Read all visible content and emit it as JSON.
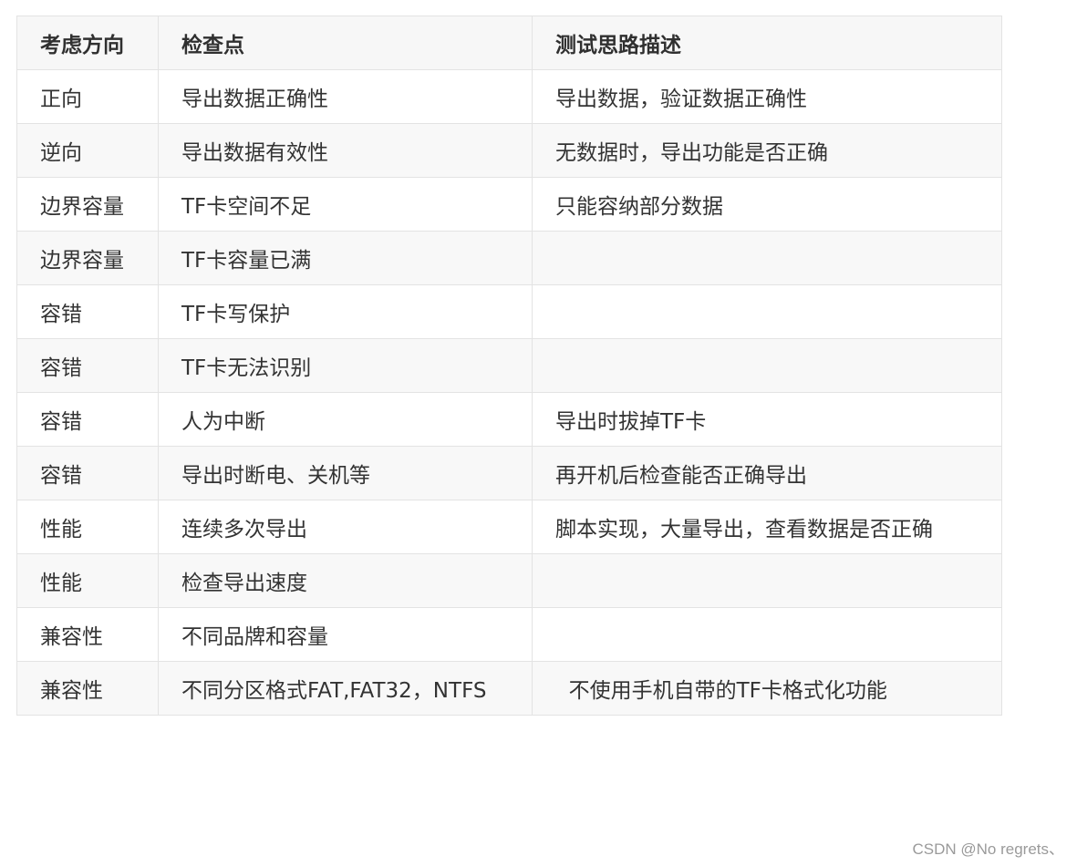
{
  "table": {
    "headers": [
      "考虑方向",
      "检查点",
      "测试思路描述"
    ],
    "rows": [
      [
        "正向",
        "导出数据正确性",
        "导出数据，验证数据正确性"
      ],
      [
        "逆向",
        "导出数据有效性",
        "无数据时，导出功能是否正确"
      ],
      [
        "边界容量",
        "TF卡空间不足",
        "只能容纳部分数据"
      ],
      [
        "边界容量",
        "TF卡容量已满",
        ""
      ],
      [
        "容错",
        "TF卡写保护",
        ""
      ],
      [
        "容错",
        "TF卡无法识别",
        ""
      ],
      [
        "容错",
        "人为中断",
        "导出时拔掉TF卡"
      ],
      [
        "容错",
        "导出时断电、关机等",
        "再开机后检查能否正确导出"
      ],
      [
        "性能",
        "连续多次导出",
        "脚本实现，大量导出，查看数据是否正确"
      ],
      [
        "性能",
        "检查导出速度",
        ""
      ],
      [
        "兼容性",
        "不同品牌和容量",
        ""
      ],
      [
        "兼容性",
        "不同分区格式FAT,FAT32，NTFS",
        "  不使用手机自带的TF卡格式化功能"
      ]
    ]
  },
  "watermark": "CSDN @No regrets、"
}
